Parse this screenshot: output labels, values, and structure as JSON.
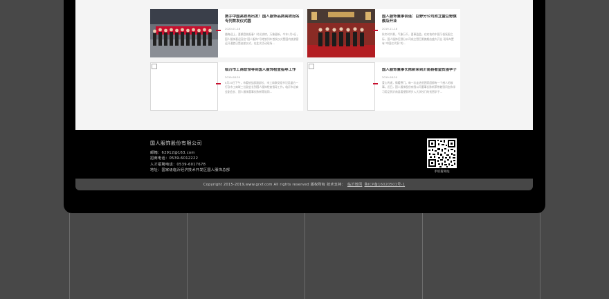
{
  "news": [
    {
      "title": "携手中国高铁再出发！国人服饰品牌高铁冠名专列首发仪式圆",
      "date": "2020-01-18",
      "desc": "腊梅迎上，喜鹊登枝报春！时光流转，万象更新，今年1月9日，国人服饰喜迎冠名“国人服饰”号地铁列车首发仪式暨国内旅游客运开通首日暨启航仪式，在此次活动现场…",
      "has_photo": true
    },
    {
      "title": "国人服饰董事会连：巨野分公司成立暨巨野旗舰店开业",
      "date": "2019-11-18",
      "desc": "秋冬时节景，气象万千，喜事盈盈。在欢快的中国习俗氛围之际，国人服饰巨野分公司成立暨巨野旗舰店盛大开业 现场布置有“中国红代表”的…",
      "has_photo": true
    },
    {
      "title": "临沂市工商联领导到国人服饰检查指导工作",
      "date": "2019-08-20",
      "desc": "8月20日下午，市委统战部副部长、市工商联党组书记吴晶方一行及市工商联三位副会长到国人服饰检查指导工作，临沂市总商会副会长、国人服饰董事长陈新等陪同…",
      "has_photo": false
    },
    {
      "title": "国人服饰董事长陈新荣到沂南县看望贫困学子",
      "date": "2019-08-20",
      "desc": "爱心传递，情暖寒门。每一次走进贫困家庭都有一个感人的故事。近日，国人服饰股份有限公司董事长陈新荣带着慰问金和学习用品到沂南县看望即将步入大学校门的贫困学子…",
      "has_photo": false
    }
  ],
  "footer": {
    "company": "国人服饰股份有限公司",
    "contacts": [
      "邮箱：62912@163.com",
      "招商电话：0539-6012222",
      "人才招聘电话：0539-6017678",
      "地址：国家级临沂经济技术开发区国人服饰总部"
    ],
    "qr_label": "手机看网站",
    "copyright": "Copyright 2015-2019,www.grxf.com All rights reserved 版权所有 技术支持：",
    "tech_link": "临沂微网",
    "icp_link": "鲁ICP备16020501号-1"
  },
  "colors": {
    "accent": "#c8102e",
    "frame": "#000000",
    "background": "#484848"
  }
}
